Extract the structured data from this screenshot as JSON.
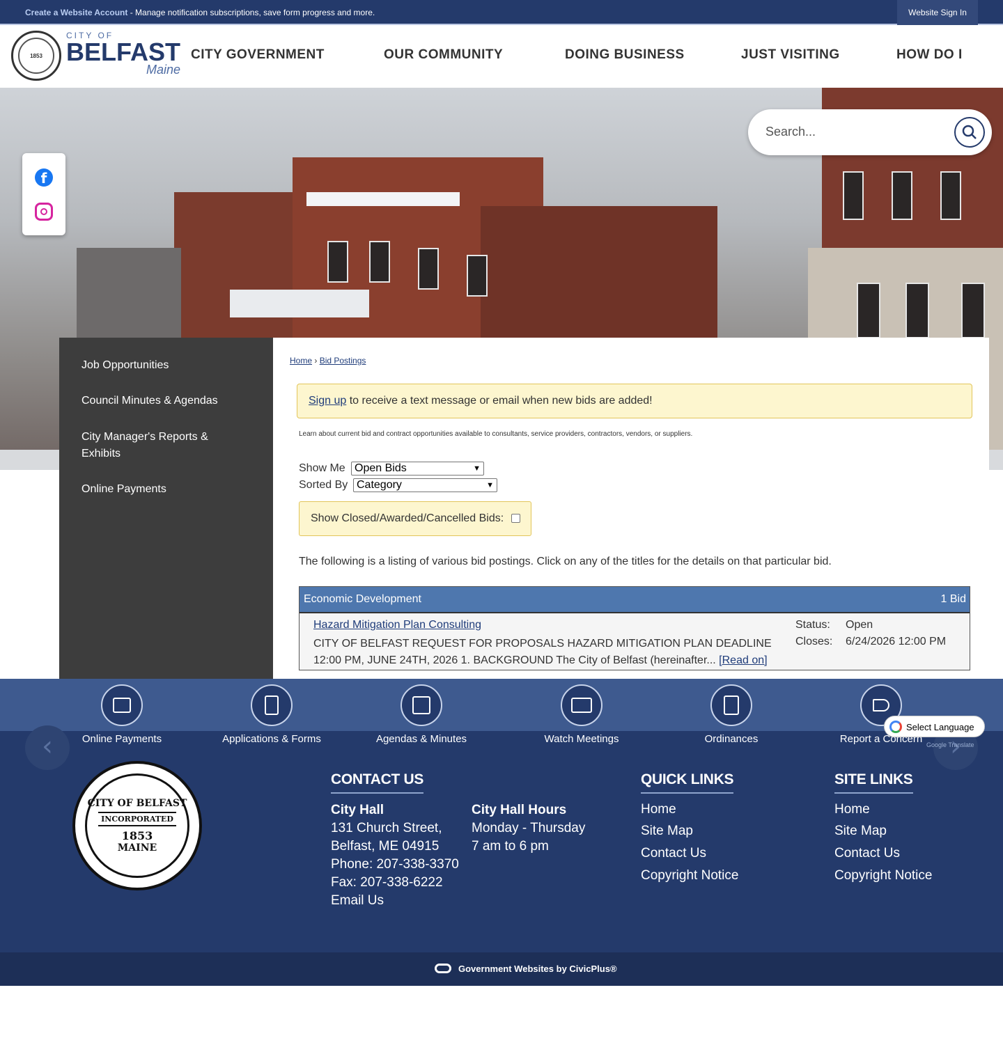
{
  "topbar": {
    "create_account": "Create a Website Account",
    "create_account_rest": " - Manage notification subscriptions, save form progress and more.",
    "signin": "Website Sign In"
  },
  "logo": {
    "city_of": "CITY OF",
    "belfast": "BELFAST",
    "maine": "Maine",
    "seal_top": "CITY OF BELFAST",
    "seal_mid": "INCORPORATED",
    "seal_year": "1853",
    "seal_bottom": "MAINE"
  },
  "nav": [
    "CITY GOVERNMENT",
    "OUR COMMUNITY",
    "DOING BUSINESS",
    "JUST VISITING",
    "HOW DO I"
  ],
  "search": {
    "placeholder": "Search..."
  },
  "social": {
    "facebook": "f"
  },
  "sidebar": {
    "items": [
      "Job Opportunities",
      "Council Minutes & Agendas",
      "City Manager's Reports & Exhibits",
      "Online Payments"
    ]
  },
  "breadcrumb": {
    "home": "Home",
    "sep": " › ",
    "current": "Bid Postings"
  },
  "alert": {
    "link": "Sign up",
    "rest": " to receive a text message or email when new bids are added!"
  },
  "learn": "Learn about current bid and contract opportunities available to consultants, service providers, contractors, vendors, or suppliers.",
  "filters": {
    "show_me_label": "Show Me",
    "show_me_value": "Open Bids",
    "sorted_by_label": "Sorted By",
    "sorted_by_value": "Category",
    "closed_label": "Show Closed/Awarded/Cancelled Bids:"
  },
  "listing_text": "The following is a listing of various bid postings. Click on any of the titles for the details on that particular bid.",
  "bids": {
    "category": "Economic Development",
    "count": "1 Bid",
    "item": {
      "title": "Hazard Mitigation Plan Consulting",
      "desc": "CITY OF BELFAST REQUEST FOR PROPOSALS HAZARD MITIGATION PLAN DEADLINE 12:00 PM, JUNE 24TH, 2026 1. BACKGROUND The City of Belfast (hereinafter... ",
      "read_on": "[Read on]",
      "status_label": "Status:",
      "status_value": "Open",
      "closes_label": "Closes:",
      "closes_value": "6/24/2026 12:00 PM"
    }
  },
  "quick_icons": [
    "Online Payments",
    "Applications & Forms",
    "Agendas & Minutes",
    "Watch Meetings",
    "Ordinances",
    "Report a Concern"
  ],
  "arrows": {
    "prev": "‹",
    "next": "›"
  },
  "translate": {
    "label": "Select Language",
    "powered": "Google Translate"
  },
  "footer": {
    "contact_heading": "CONTACT US",
    "city_hall": "City Hall",
    "address1": "131 Church Street,",
    "address2": "Belfast, ME 04915",
    "phone": "Phone: 207-338-3370",
    "fax": "Fax: 207-338-6222",
    "email": "Email Us",
    "hours_heading": "City Hall Hours",
    "hours_days": "Monday - Thursday",
    "hours_time": "7 am to 6 pm",
    "quick_heading": "QUICK LINKS",
    "quick_links": [
      "Home",
      "Site Map",
      "Contact Us",
      "Copyright Notice"
    ],
    "site_heading": "SITE LINKS",
    "site_links": [
      "Home",
      "Site Map",
      "Contact Us",
      "Copyright Notice"
    ]
  },
  "civicplus": "Government Websites by CivicPlus®"
}
